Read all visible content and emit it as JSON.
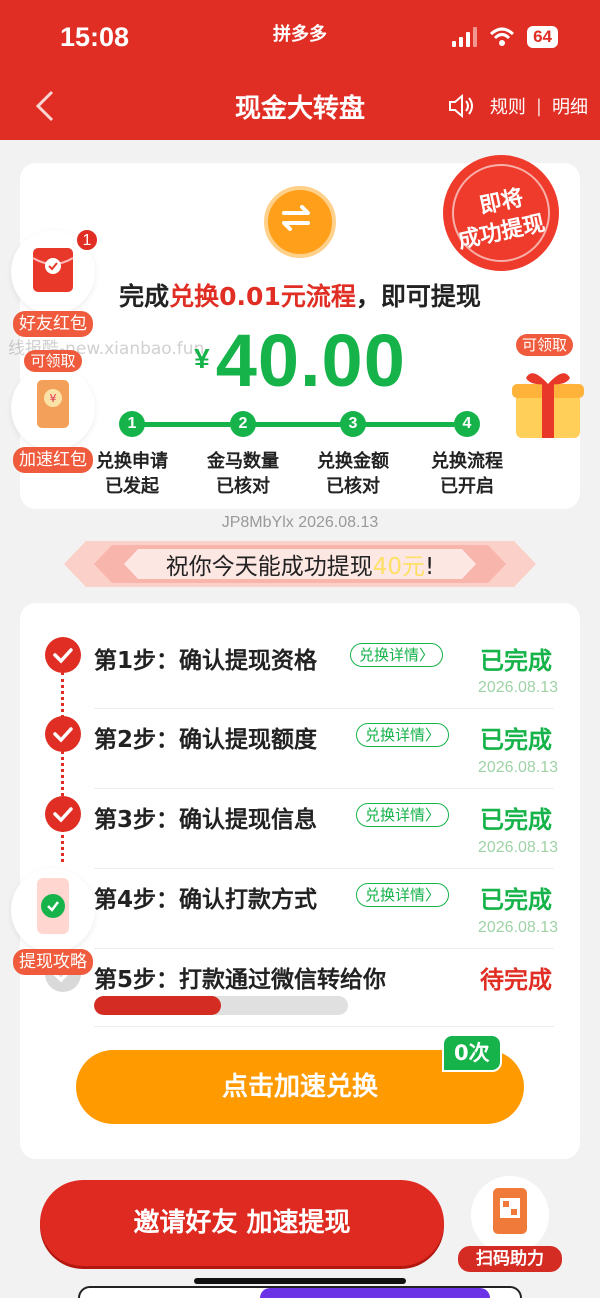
{
  "status_bar": {
    "time": "15:08",
    "app": "拼多多",
    "battery": "64"
  },
  "nav": {
    "title": "现金大转盘",
    "rules": "规则",
    "divider": "|",
    "details": "明细"
  },
  "seal": {
    "line1": "即将",
    "line2": "成功提现"
  },
  "headline": {
    "prefix": "完成",
    "highlight": "兑换0.01元流程",
    "suffix": "，即可提现"
  },
  "amount": {
    "currency": "¥",
    "value": "40.00"
  },
  "watermark": "线报酷-new.xianbao.fun",
  "progress_steps": [
    {
      "num": "1",
      "line1": "兑换申请",
      "line2": "已发起"
    },
    {
      "num": "2",
      "line1": "金马数量",
      "line2": "已核对"
    },
    {
      "num": "3",
      "line1": "兑换金额",
      "line2": "已核对"
    },
    {
      "num": "4",
      "line1": "兑换流程",
      "line2": "已开启"
    }
  ],
  "floats": {
    "friend_redpack": {
      "label": "好友红包",
      "badge": "1"
    },
    "speed_redpack": {
      "tag": "可领取",
      "label": "加速红包"
    },
    "gift": {
      "tag": "可领取"
    },
    "guide": {
      "label": "提现攻略"
    },
    "scan": {
      "label": "扫码助力"
    }
  },
  "code_line": "JP8MbYlx 2026.08.13",
  "banner": {
    "prefix": "祝你今天能成功提现",
    "highlight": "40元",
    "suffix": "!"
  },
  "steps": [
    {
      "title": "第1步：确认提现资格",
      "detail": "兑换详情",
      "status": "已完成",
      "date": "2026.08.13"
    },
    {
      "title": "第2步：确认提现额度",
      "detail": "兑换详情",
      "status": "已完成",
      "date": "2026.08.13"
    },
    {
      "title": "第3步：确认提现信息",
      "detail": "兑换详情",
      "status": "已完成",
      "date": "2026.08.13"
    },
    {
      "title": "第4步：确认打款方式",
      "detail": "兑换详情",
      "status": "已完成",
      "date": "2026.08.13"
    },
    {
      "title": "第5步：打款通过微信转给你",
      "status": "待完成",
      "progress": 0.5
    }
  ],
  "buttons": {
    "speed_count": "0次",
    "speed": "点击加速兑换",
    "invite": "邀请好友 加速提现"
  },
  "colors": {
    "brand_red": "#e02e24",
    "green": "#16b34a",
    "orange": "#ff9a00"
  }
}
